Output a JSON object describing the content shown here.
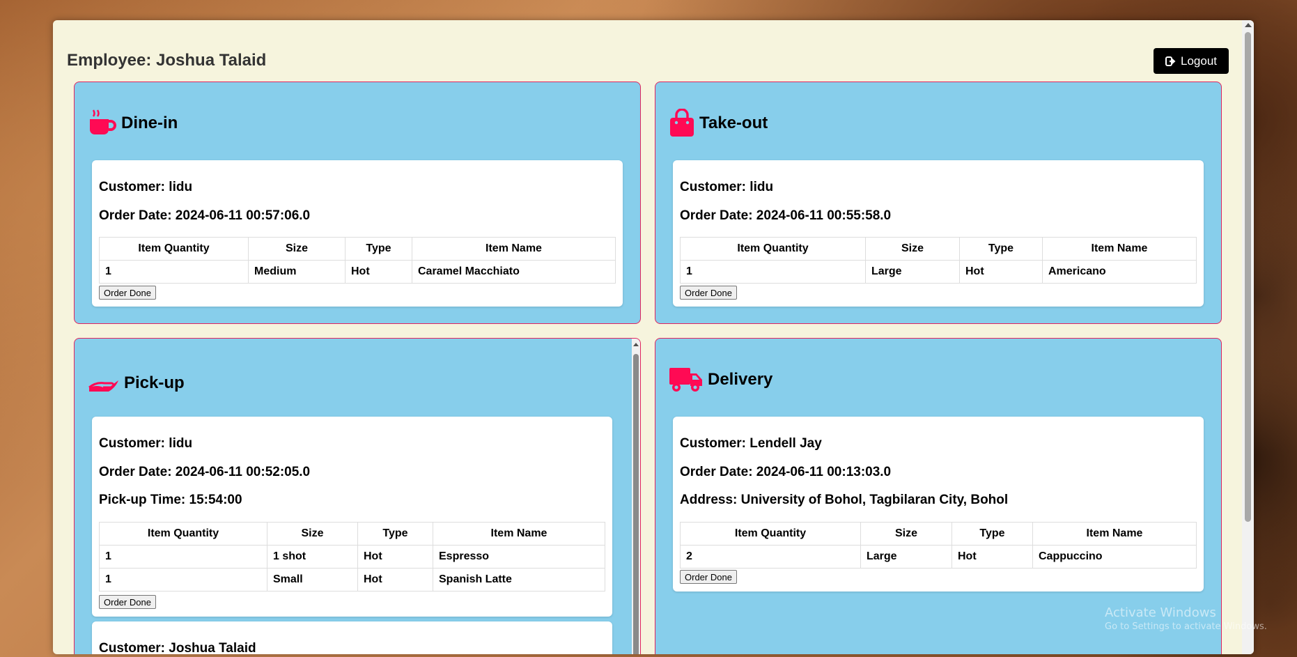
{
  "header": {
    "employee_label": "Employee: Joshua Talaid",
    "logout_label": "Logout"
  },
  "panels": {
    "dinein": {
      "title": "Dine-in",
      "icon": "coffee-cup-icon",
      "orders": [
        {
          "customer": "Customer: lidu",
          "order_date": "Order Date: 2024-06-11 00:57:06.0",
          "columns": [
            "Item Quantity",
            "Size",
            "Type",
            "Item Name"
          ],
          "rows": [
            [
              "1",
              "Medium",
              "Hot",
              "Caramel Macchiato"
            ]
          ],
          "done_label": "Order Done"
        }
      ]
    },
    "takeout": {
      "title": "Take-out",
      "icon": "shopping-bag-icon",
      "orders": [
        {
          "customer": "Customer: lidu",
          "order_date": "Order Date: 2024-06-11 00:55:58.0",
          "columns": [
            "Item Quantity",
            "Size",
            "Type",
            "Item Name"
          ],
          "rows": [
            [
              "1",
              "Large",
              "Hot",
              "Americano"
            ]
          ],
          "done_label": "Order Done"
        }
      ]
    },
    "pickup": {
      "title": "Pick-up",
      "icon": "hand-holding-icon",
      "orders": [
        {
          "customer": "Customer: lidu",
          "order_date": "Order Date: 2024-06-11 00:52:05.0",
          "pickup_time": "Pick-up Time: 15:54:00",
          "columns": [
            "Item Quantity",
            "Size",
            "Type",
            "Item Name"
          ],
          "rows": [
            [
              "1",
              "1 shot",
              "Hot",
              "Espresso"
            ],
            [
              "1",
              "Small",
              "Hot",
              "Spanish Latte"
            ]
          ],
          "done_label": "Order Done"
        },
        {
          "customer": "Customer: Joshua Talaid"
        }
      ]
    },
    "delivery": {
      "title": "Delivery",
      "icon": "truck-icon",
      "orders": [
        {
          "customer": "Customer: Lendell Jay",
          "order_date": "Order Date: 2024-06-11 00:13:03.0",
          "address": "Address: University of Bohol, Tagbilaran City, Bohol",
          "columns": [
            "Item Quantity",
            "Size",
            "Type",
            "Item Name"
          ],
          "rows": [
            [
              "2",
              "Large",
              "Hot",
              "Cappuccino"
            ]
          ],
          "done_label": "Order Done"
        }
      ]
    }
  },
  "watermark": {
    "title": "Activate Windows",
    "subtitle": "Go to Settings to activate Windows."
  },
  "colors": {
    "panel_bg": "#87ceeb",
    "panel_border": "#e0245e",
    "icon_accent": "#ff0a54",
    "window_bg": "#f6f4dd",
    "logout_bg": "#000000"
  }
}
